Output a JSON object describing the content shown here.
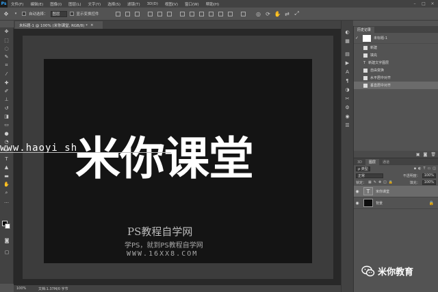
{
  "app": {
    "logo": "Ps"
  },
  "menu": [
    "文件(F)",
    "编辑(E)",
    "图像(I)",
    "图层(L)",
    "文字(Y)",
    "选择(S)",
    "滤镜(T)",
    "3D(D)",
    "视图(V)",
    "窗口(W)",
    "帮助(H)"
  ],
  "options": {
    "auto_select_label": "自动选择：",
    "auto_select_value": "图层",
    "show_transform_label": "显示变换控件"
  },
  "document": {
    "tab_title": "未标题-1 @ 100% (米你课堂, RGB/8) *",
    "canvas_text": "米你课堂"
  },
  "watermarks": {
    "url": "www.haoyi  sh",
    "ps_title": "PS教程自学网",
    "subtitle": "学PS，就到PS教程自学网",
    "domain": "WWW.16XX8.COM"
  },
  "status": {
    "zoom": "100%",
    "doc_info": "文档:1.37M/0 字节"
  },
  "history_panel": {
    "tabs": [
      "历史记录"
    ],
    "snapshot_name": "未标题-1",
    "items": [
      "新建",
      "填充",
      "新建文字图层",
      "自由变换",
      "水平居中对齐",
      "垂直居中对齐"
    ],
    "selected_index": 5
  },
  "layers_panel": {
    "tabs": [
      "3D",
      "图层",
      "通道"
    ],
    "filter_label": "ρ 类型",
    "blend_mode": "正常",
    "opacity_label": "不透明度：",
    "opacity_value": "100%",
    "lock_label": "锁定：",
    "fill_label": "填充：",
    "fill_value": "100%",
    "layers": [
      {
        "name": "米你课堂",
        "type": "text",
        "selected": true
      },
      {
        "name": "背景",
        "type": "background",
        "selected": false
      }
    ]
  },
  "brand": {
    "text": "米你教育"
  },
  "colors": {
    "accent": "#31a8ff",
    "fg": "#000000",
    "bg": "#ffffff"
  }
}
